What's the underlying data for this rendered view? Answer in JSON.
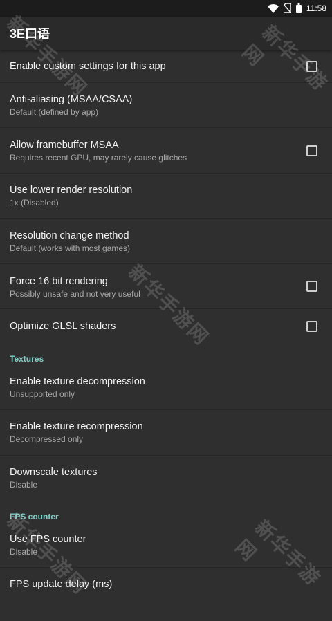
{
  "status_bar": {
    "time": "11:58",
    "icons": [
      "wifi-icon",
      "no-sim-icon",
      "battery-icon"
    ]
  },
  "app_bar": {
    "title": "3E口语"
  },
  "items": [
    {
      "title": "Enable custom settings for this app",
      "checkbox": true
    },
    {
      "title": "Anti-aliasing (MSAA/CSAA)",
      "summary": "Default (defined by app)"
    },
    {
      "title": "Allow framebuffer MSAA",
      "summary": "Requires recent GPU, may rarely cause glitches",
      "checkbox": true
    },
    {
      "title": "Use lower render resolution",
      "summary": "1x (Disabled)"
    },
    {
      "title": "Resolution change method",
      "summary": "Default (works with most games)"
    },
    {
      "title": "Force 16 bit rendering",
      "summary": "Possibly unsafe and not very useful",
      "checkbox": true
    },
    {
      "title": "Optimize GLSL shaders",
      "checkbox": true
    }
  ],
  "section_textures": "Textures",
  "texture_items": [
    {
      "title": "Enable texture decompression",
      "summary": "Unsupported only"
    },
    {
      "title": "Enable texture recompression",
      "summary": "Decompressed only"
    },
    {
      "title": "Downscale textures",
      "summary": "Disable"
    }
  ],
  "section_fps": "FPS counter",
  "fps_items": [
    {
      "title": "Use FPS counter",
      "summary": "Disable"
    },
    {
      "title": "FPS update delay (ms)"
    }
  ],
  "watermark": "新华手游网",
  "colors": {
    "background": "#2f2f2f",
    "appbar": "#2a2a2a",
    "section_accent": "#7fcfc8"
  }
}
